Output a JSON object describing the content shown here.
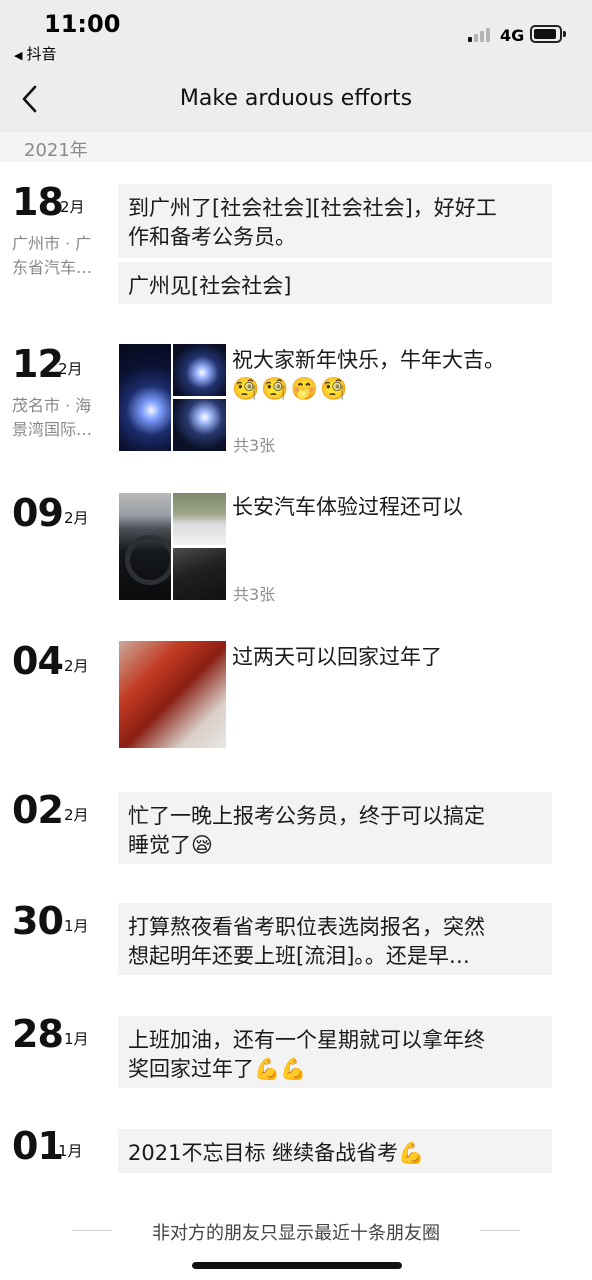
{
  "status_bar": {
    "time": "11:00",
    "back_app": "抖音",
    "network": "4G"
  },
  "nav": {
    "title": "Make arduous efforts"
  },
  "year_label": "2021年",
  "posts": [
    {
      "day": "18",
      "month": "2月",
      "location_line1": "广州市 · 广",
      "location_line2": "东省汽车…",
      "text_box1_line1": "到广州了[社会社会][社会社会]，好好工",
      "text_box1_line2": "作和备考公务员。",
      "text_box2": "广州见[社会社会]"
    },
    {
      "day": "12",
      "month": "2月",
      "location_line1": "茂名市 · 海",
      "location_line2": "景湾国际…",
      "text": "祝大家新年快乐，牛年大吉。",
      "emojis": "🧐🧐🤭🧐",
      "photo_count": "共3张"
    },
    {
      "day": "09",
      "month": "2月",
      "text": "长安汽车体验过程还可以",
      "photo_count": "共3张"
    },
    {
      "day": "04",
      "month": "2月",
      "text": "过两天可以回家过年了"
    },
    {
      "day": "02",
      "month": "2月",
      "line1": "忙了一晚上报考公务员，终于可以搞定",
      "line2": "睡觉了😪"
    },
    {
      "day": "30",
      "month": "1月",
      "line1": "打算熬夜看省考职位表选岗报名，突然",
      "line2": "想起明年还要上班[流泪]。。还是早…"
    },
    {
      "day": "28",
      "month": "1月",
      "line1": "上班加油，还有一个星期就可以拿年终",
      "line2": "奖回家过年了💪💪"
    },
    {
      "day": "01",
      "month": "1月",
      "line1": "2021不忘目标 继续备战省考💪"
    }
  ],
  "footer": {
    "note": "非对方的朋友只显示最近十条朋友圈"
  }
}
